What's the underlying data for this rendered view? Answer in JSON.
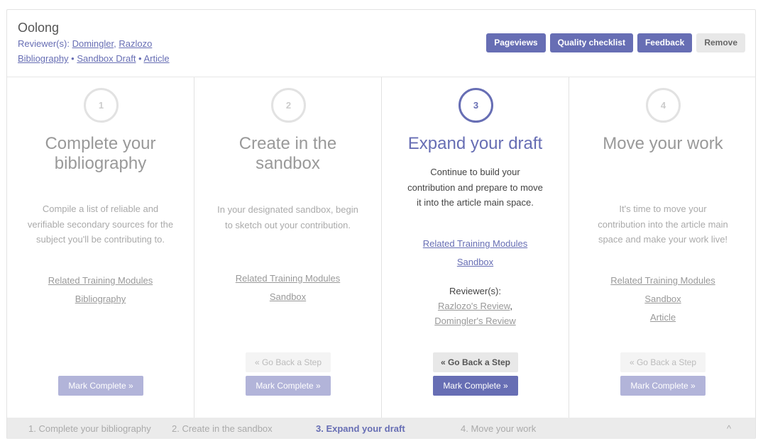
{
  "header": {
    "title": "Oolong",
    "reviewers_label": "Reviewer(s):",
    "reviewers": [
      "Domingler",
      "Razlozo"
    ],
    "links": [
      "Bibliography",
      "Sandbox Draft",
      "Article"
    ],
    "buttons": {
      "pageviews": "Pageviews",
      "quality": "Quality checklist",
      "feedback": "Feedback",
      "remove": "Remove"
    }
  },
  "steps": [
    {
      "number": "1",
      "title": "Complete your bibliography",
      "description": "Compile a list of reliable and verifiable secondary sources for the subject you'll be contributing to.",
      "links": [
        "Related Training Modules",
        "Bibliography"
      ],
      "mark": "Mark Complete »"
    },
    {
      "number": "2",
      "title": "Create in the sandbox",
      "description": "In your designated sandbox, begin to sketch out your contribution.",
      "links": [
        "Related Training Modules",
        "Sandbox"
      ],
      "back": "« Go Back a Step",
      "mark": "Mark Complete »"
    },
    {
      "number": "3",
      "title": "Expand your draft",
      "description": "Continue to build your contribution and prepare to move it into the article main space.",
      "links": [
        "Related Training Modules",
        "Sandbox"
      ],
      "reviewers_label": "Reviewer(s):",
      "reviews": [
        "Razlozo's Review",
        "Domingler's Review"
      ],
      "back": "« Go Back a Step",
      "mark": "Mark Complete »"
    },
    {
      "number": "4",
      "title": "Move your work",
      "description": "It's time to move your contribution into the article main space and make your work live!",
      "links": [
        "Related Training Modules",
        "Sandbox",
        "Article"
      ],
      "back": "« Go Back a Step",
      "mark": "Mark Complete »"
    }
  ],
  "footer": {
    "steps": [
      "1. Complete your bibliography",
      "2. Create in the sandbox",
      "3. Expand your draft",
      "4. Move your work"
    ],
    "collapse_icon": "^"
  },
  "colors": {
    "accent": "#676eb4",
    "accent_light": "#b2b4d9"
  }
}
